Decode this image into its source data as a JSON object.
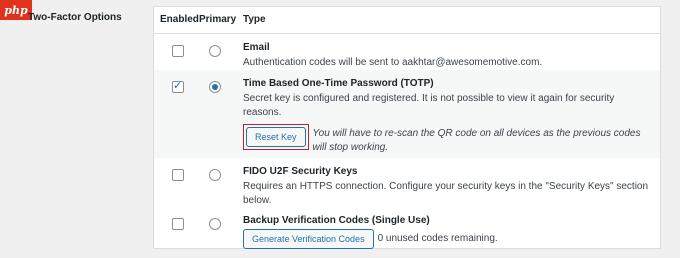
{
  "header": {
    "logo_text": "php",
    "label": "Two-Factor Options"
  },
  "columns": {
    "enabled": "Enabled",
    "primary": "Primary",
    "type": "Type"
  },
  "methods": [
    {
      "title": "Email",
      "description": "Authentication codes will be sent to aakhtar@awesomemotive.com.",
      "enabled": false,
      "primary": false
    },
    {
      "title": "Time Based One-Time Password (TOTP)",
      "description": "Secret key is configured and registered. It is not possible to view it again for security reasons.",
      "enabled": true,
      "primary": true,
      "button_label": "Reset Key",
      "note": "You will have to re-scan the QR code on all devices as the previous codes will stop working."
    },
    {
      "title": "FIDO U2F Security Keys",
      "description": "Requires an HTTPS connection. Configure your security keys in the \"Security Keys\" section below.",
      "enabled": false,
      "primary": false
    },
    {
      "title": "Backup Verification Codes (Single Use)",
      "enabled": false,
      "primary": false,
      "button_label": "Generate Verification Codes",
      "count_text": "0 unused codes remaining."
    }
  ],
  "colors": {
    "accent": "#2271b1",
    "highlight": "#c0202f",
    "php_logo": "#e0321d"
  }
}
